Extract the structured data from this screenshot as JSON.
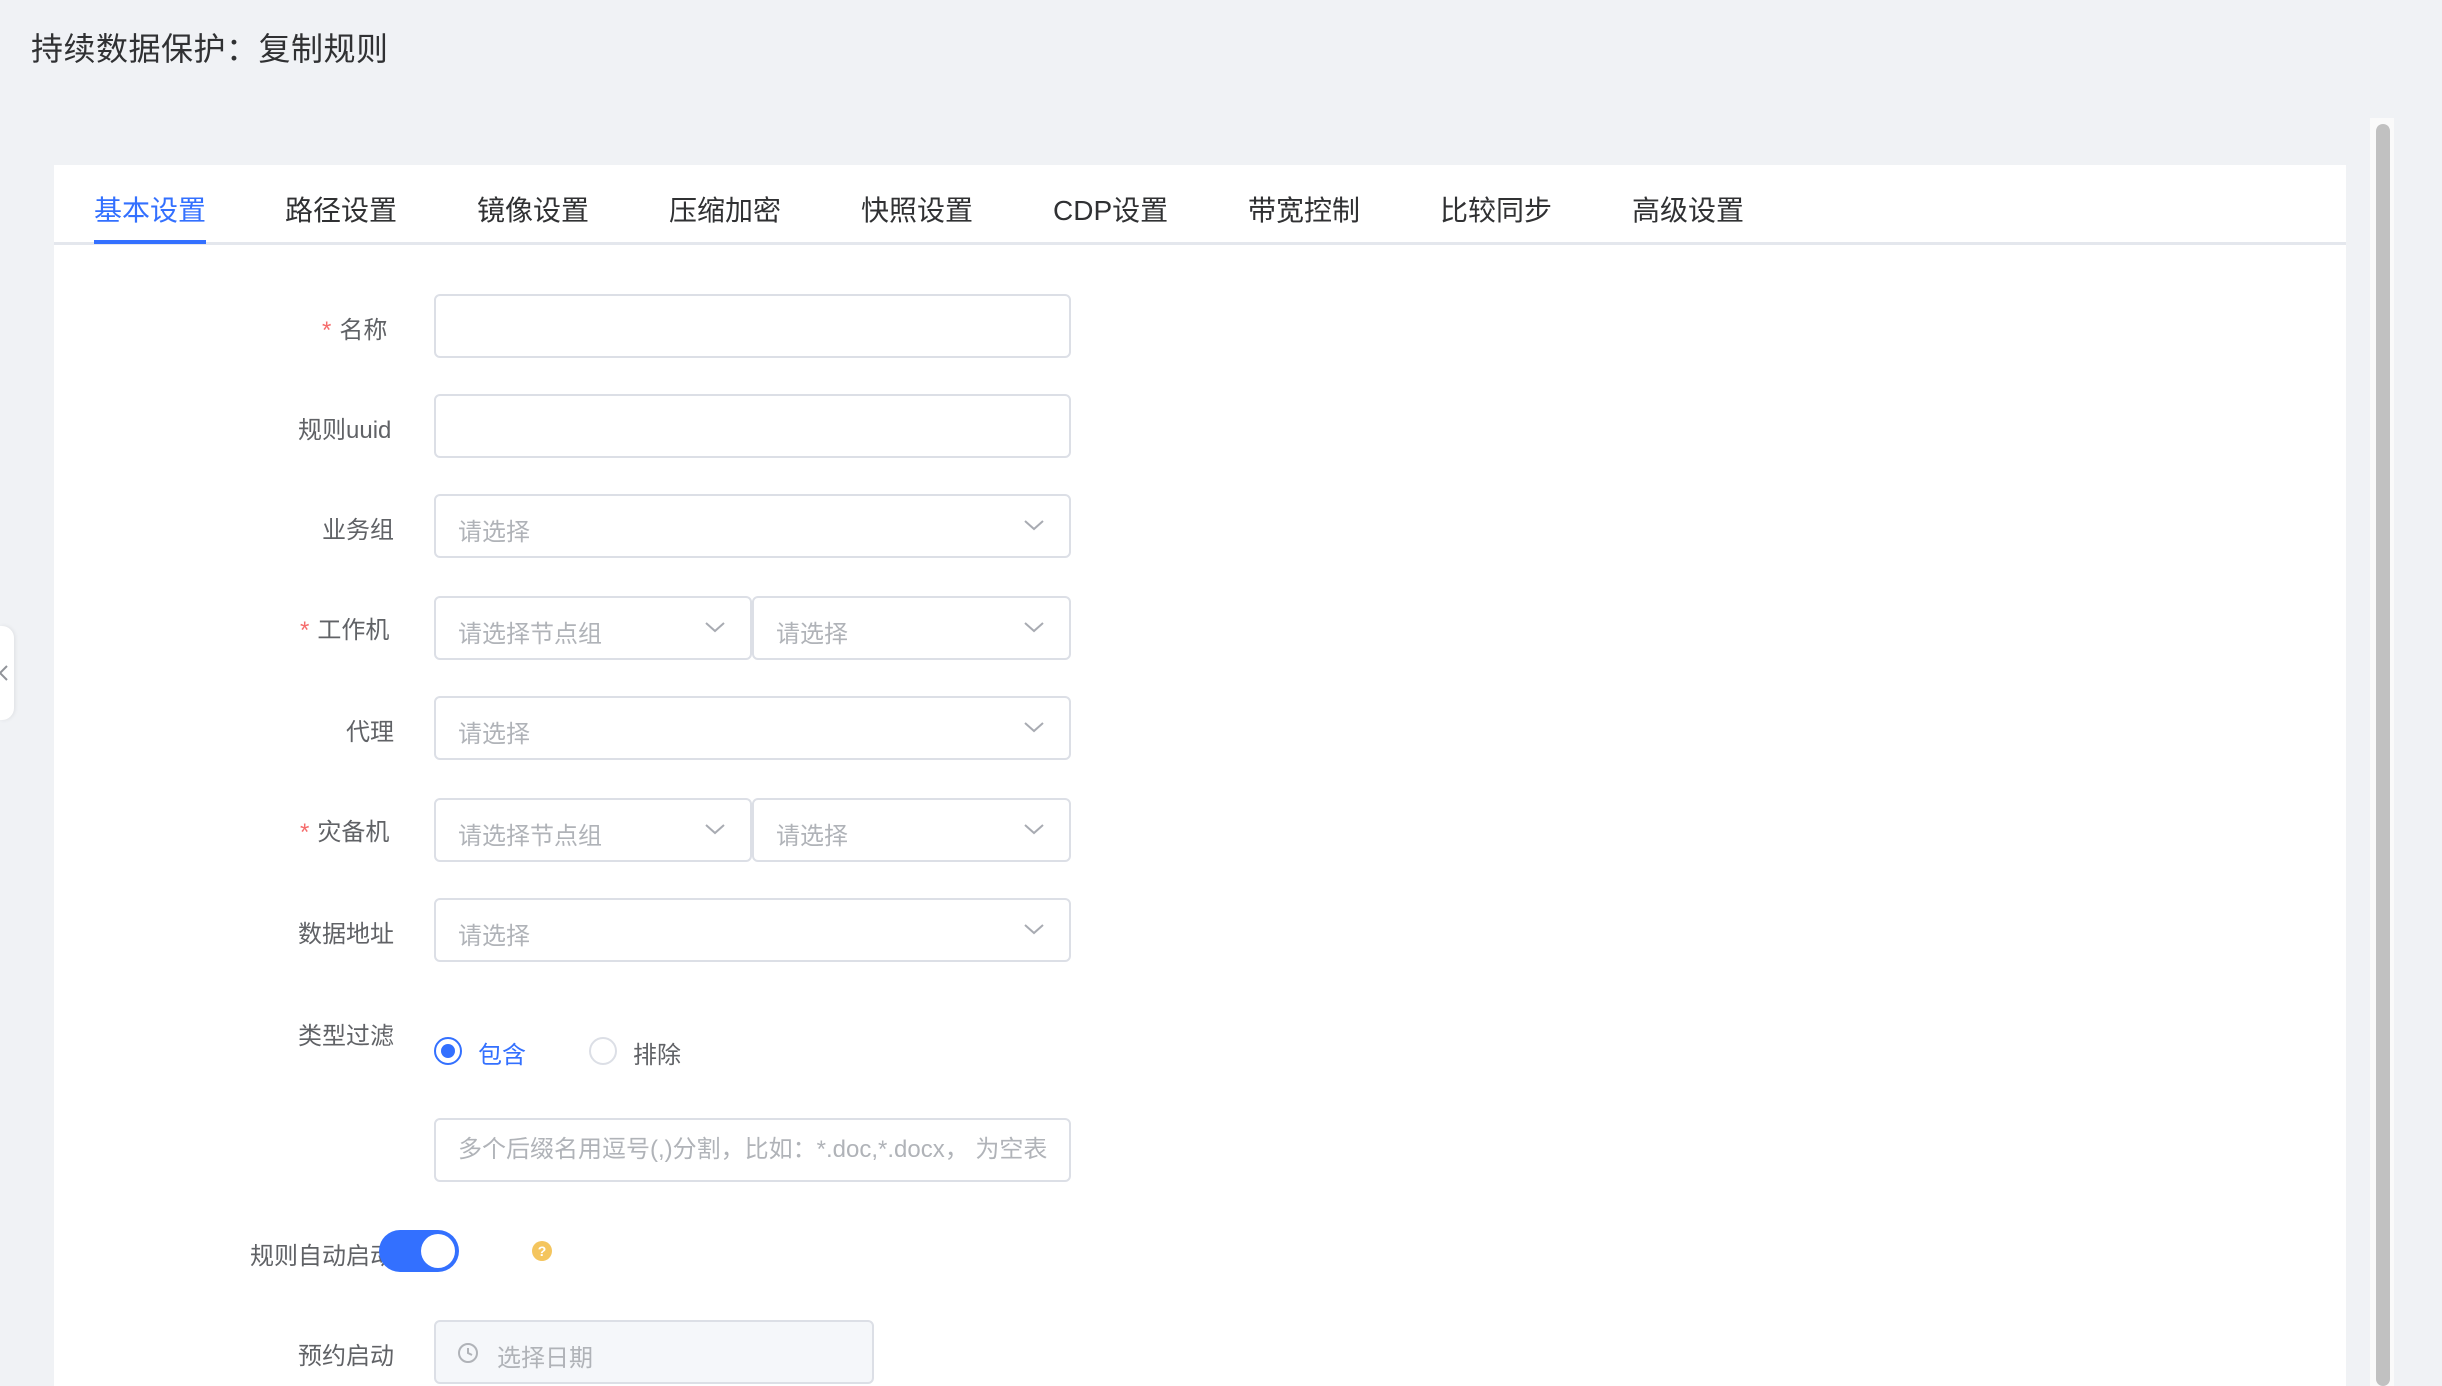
{
  "page": {
    "title": "持续数据保护：复制规则"
  },
  "tabs": [
    {
      "label": "基本设置",
      "active": true
    },
    {
      "label": "路径设置"
    },
    {
      "label": "镜像设置"
    },
    {
      "label": "压缩加密"
    },
    {
      "label": "快照设置"
    },
    {
      "label": "CDP设置"
    },
    {
      "label": "带宽控制"
    },
    {
      "label": "比较同步"
    },
    {
      "label": "高级设置"
    }
  ],
  "form": {
    "required_mark": "*",
    "name": {
      "label": "名称",
      "value": ""
    },
    "uuid": {
      "label": "规则uuid",
      "value": ""
    },
    "business_group": {
      "label": "业务组",
      "placeholder": "请选择"
    },
    "work_machine": {
      "label": "工作机",
      "node_group_placeholder": "请选择节点组",
      "placeholder": "请选择"
    },
    "proxy": {
      "label": "代理",
      "placeholder": "请选择"
    },
    "backup_machine": {
      "label": "灾备机",
      "node_group_placeholder": "请选择节点组",
      "placeholder": "请选择"
    },
    "data_address": {
      "label": "数据地址",
      "placeholder": "请选择"
    },
    "type_filter": {
      "label": "类型过滤",
      "options": [
        "包含",
        "排除"
      ],
      "selected": "包含",
      "placeholder": "多个后缀名用逗号(,)分割，比如：*.doc,*.docx， 为空表示全部"
    },
    "auto_start": {
      "label": "规则自动启动",
      "enabled": true,
      "help_icon": "question-icon"
    },
    "schedule_start": {
      "label": "预约启动",
      "placeholder": "选择日期",
      "icon": "clock-icon"
    }
  },
  "colors": {
    "accent": "#3370ff",
    "required": "#f56c6c",
    "help": "#f4c55e"
  }
}
